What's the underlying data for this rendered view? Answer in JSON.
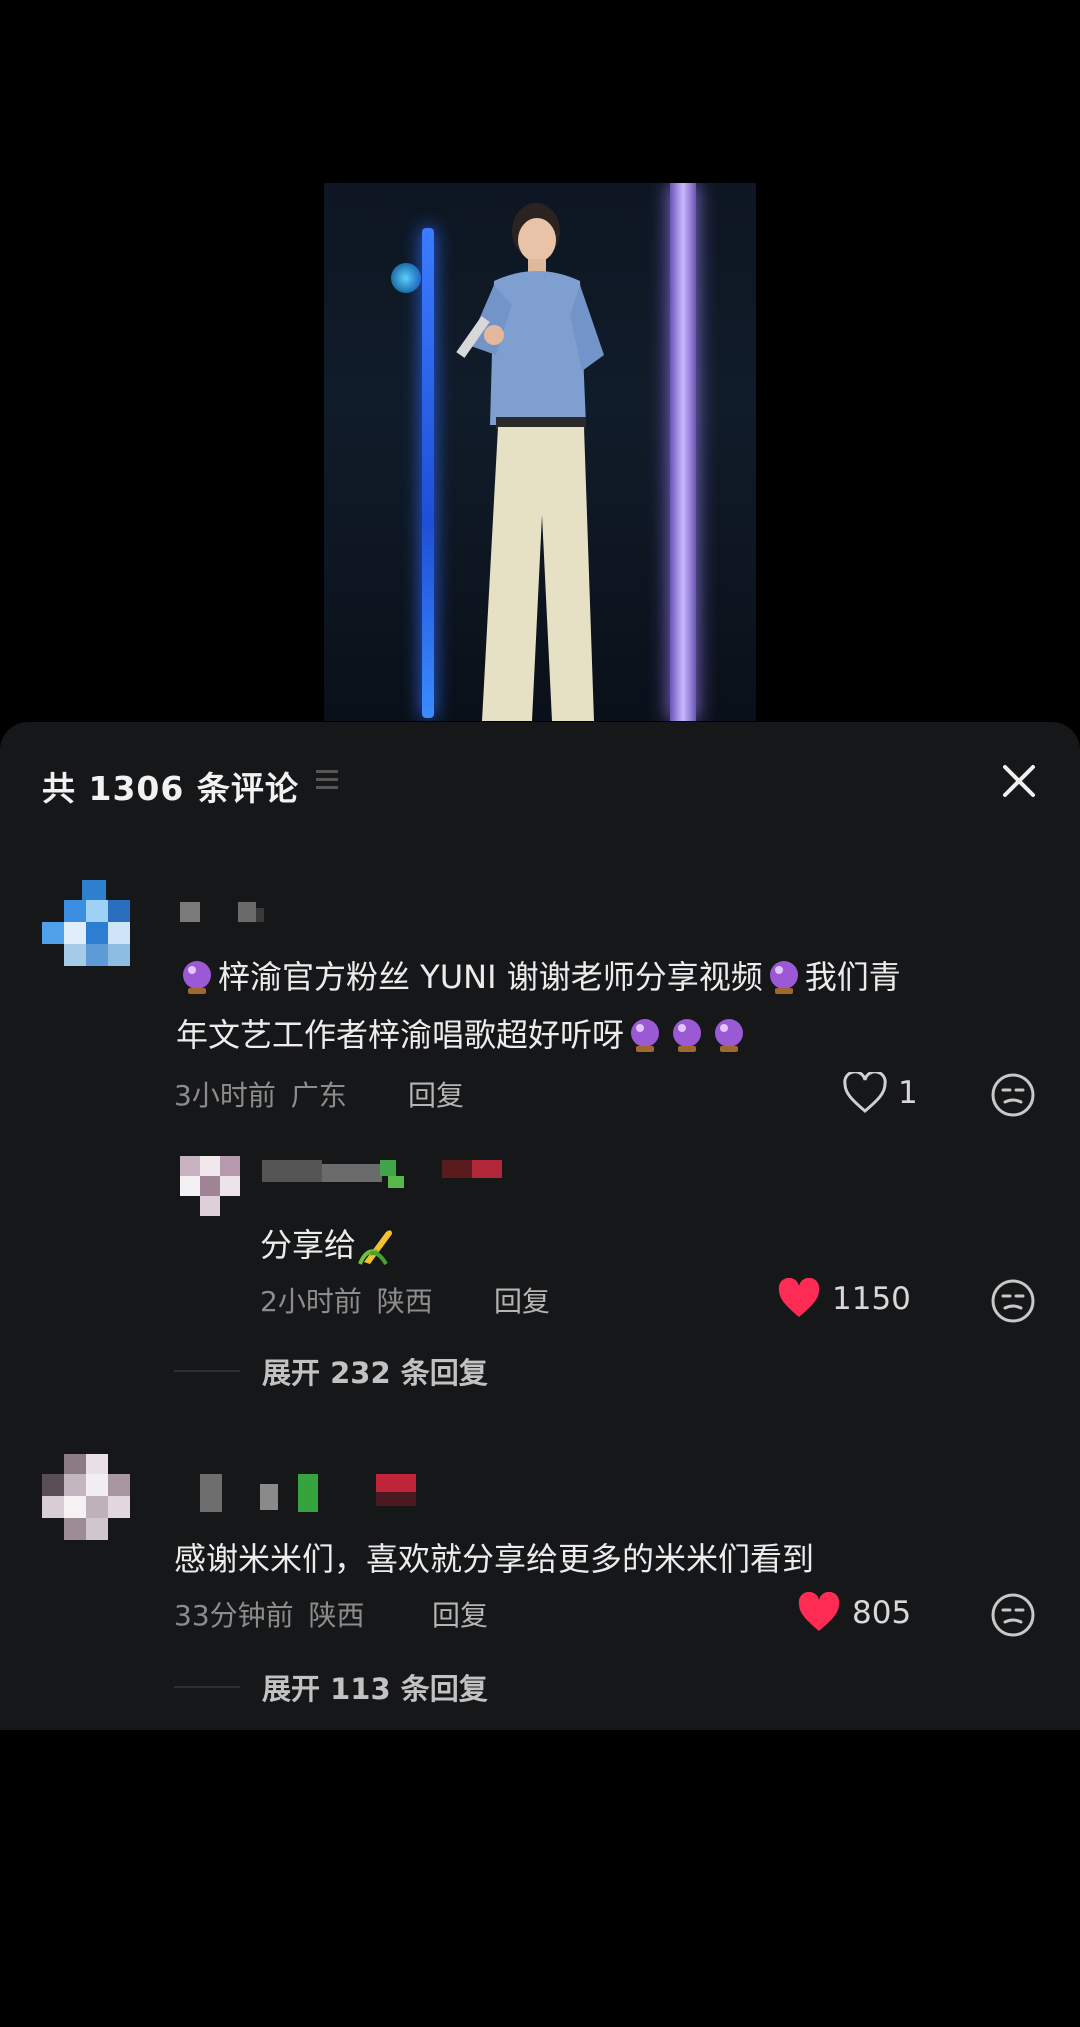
{
  "panel": {
    "title": "共 1306 条评论"
  },
  "comments": [
    {
      "text_line1": "梓渝官方粉丝 YUNI 谢谢老师分享视频",
      "text_line1_tail": "我们青",
      "text_line2": "年文艺工作者梓渝唱歌超好听呀",
      "time": "3小时前",
      "location": "广东",
      "reply_label": "回复",
      "likes": "1",
      "liked": false
    },
    {
      "text": "分享给",
      "time": "2小时前",
      "location": "陕西",
      "reply_label": "回复",
      "likes": "1150",
      "liked": true,
      "expand_label": "展开 232 条回复"
    },
    {
      "text": "感谢米米们，喜欢就分享给更多的米米们看到",
      "time": "33分钟前",
      "location": "陕西",
      "reply_label": "回复",
      "likes": "805",
      "liked": true,
      "expand_label": "展开 113 条回复"
    }
  ],
  "colors": {
    "panel_bg": "#161719",
    "like_active": "#fe2c55",
    "muted_text": "#8c8c8c"
  },
  "icons": [
    "close-icon",
    "heart-icon",
    "emoji-icon",
    "crystal-ball-icon",
    "corn-icon",
    "menu-lines-icon"
  ]
}
